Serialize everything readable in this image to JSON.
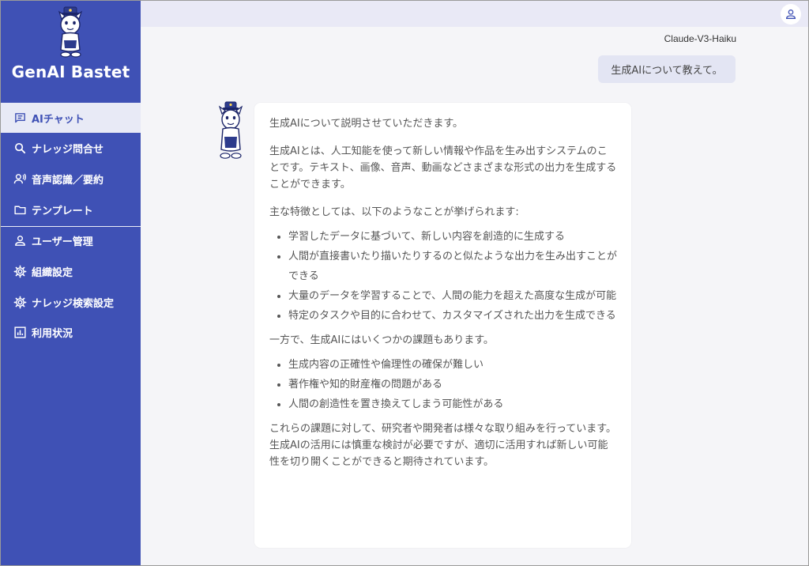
{
  "app": {
    "brand": "GenAI Bastet"
  },
  "sidebar": {
    "items": [
      {
        "label": "AIチャット",
        "icon": "chat-icon",
        "active": true
      },
      {
        "label": "ナレッジ問合せ",
        "icon": "search-icon",
        "active": false
      },
      {
        "label": "音声認識／要約",
        "icon": "voice-icon",
        "active": false
      },
      {
        "label": "テンプレート",
        "icon": "folder-icon",
        "active": false
      },
      {
        "label": "ユーザー管理",
        "icon": "user-icon",
        "active": false
      },
      {
        "label": "組織設定",
        "icon": "gear-icon",
        "active": false
      },
      {
        "label": "ナレッジ検索設定",
        "icon": "gear-icon",
        "active": false
      },
      {
        "label": "利用状況",
        "icon": "chart-icon",
        "active": false
      }
    ]
  },
  "colors": {
    "sidebar_bg": "#3f51b5",
    "active_bg": "#e8eaf6",
    "topbar_bg": "#e9e9f6",
    "user_bubble_bg": "#e3e5f3"
  },
  "chat": {
    "model": "Claude-V3-Haiku",
    "user_message": "生成AIについて教えて。",
    "answer": {
      "intro": "生成AIについて説明させていただきます。",
      "definition": "生成AIとは、人工知能を使って新しい情報や作品を生み出すシステムのことです。テキスト、画像、音声、動画などさまざまな形式の出力を生成することができます。",
      "features_lead": "主な特徴としては、以下のようなことが挙げられます:",
      "features": [
        "学習したデータに基づいて、新しい内容を創造的に生成する",
        "人間が直接書いたり描いたりするのと似たような出力を生み出すことができる",
        "大量のデータを学習することで、人間の能力を超えた高度な生成が可能",
        "特定のタスクや目的に合わせて、カスタマイズされた出力を生成できる"
      ],
      "issues_lead": "一方で、生成AIにはいくつかの課題もあります。",
      "issues": [
        "生成内容の正確性や倫理性の確保が難しい",
        "著作権や知的財産権の問題がある",
        "人間の創造性を置き換えてしまう可能性がある"
      ],
      "conclusion": "これらの課題に対して、研究者や開発者は様々な取り組みを行っています。生成AIの活用には慎重な検討が必要ですが、適切に活用すれば新しい可能性を切り開くことができると期待されています。"
    }
  }
}
